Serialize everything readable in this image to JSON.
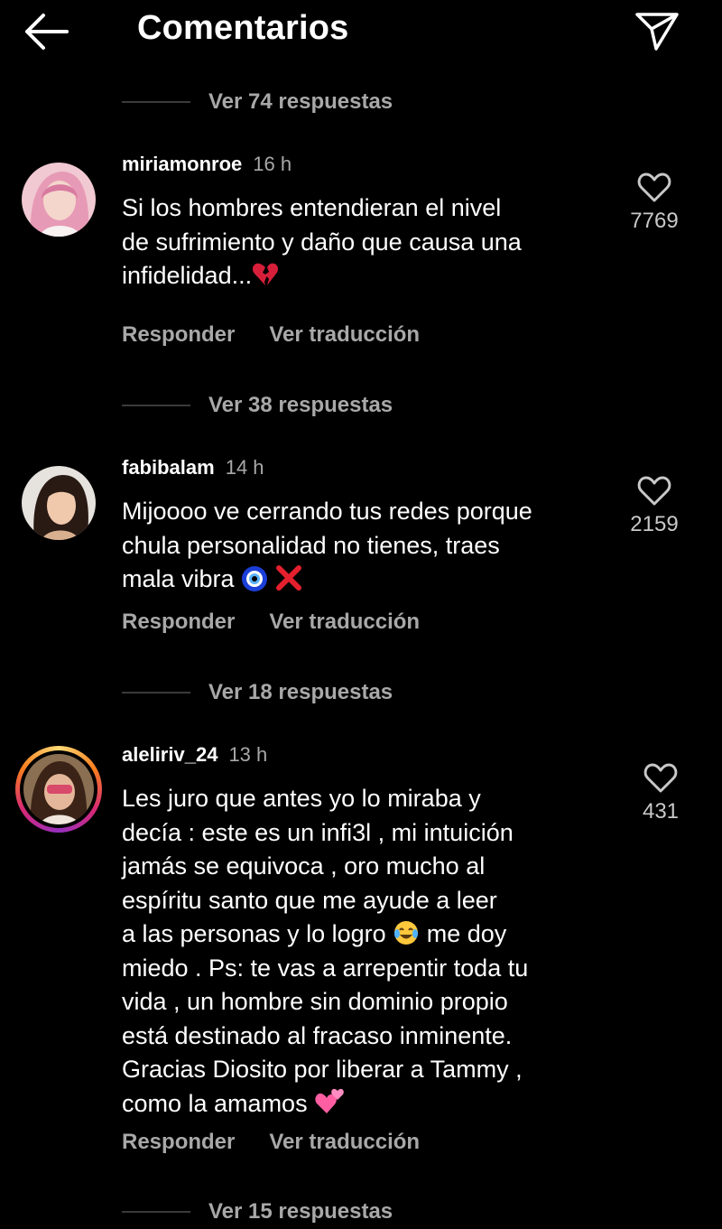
{
  "header": {
    "title": "Comentarios"
  },
  "icons": {
    "back": "arrow-left-icon",
    "send": "paper-plane-icon",
    "like": "heart-outline-icon"
  },
  "colors": {
    "background": "#000000",
    "secondary_text": "#a8a8a8",
    "story_ring": [
      "#feda75",
      "#fa7e1e",
      "#d62976",
      "#962fbf"
    ]
  },
  "threads": [
    {
      "replies_label": "Ver 74 respuestas"
    }
  ],
  "comments": [
    {
      "username": "miriamonroe",
      "time": "16 h",
      "text_lines": [
        "Si los hombres entendieran el nivel",
        "de sufrimiento y daño que causa una",
        "infidelidad..."
      ],
      "emojis": [
        "broken-heart"
      ],
      "likes": "7769",
      "reply_label": "Responder",
      "translate_label": "Ver traducción",
      "replies_label": "Ver 38 respuestas"
    },
    {
      "username": "fabibalam",
      "time": "14 h",
      "text_lines": [
        "Mijoooo ve cerrando tus redes porque",
        "chula personalidad no tienes, traes",
        "mala vibra"
      ],
      "emojis": [
        "nazar-amulet",
        "cross-mark"
      ],
      "likes": "2159",
      "reply_label": "Responder",
      "translate_label": "Ver traducción",
      "replies_label": "Ver 18 respuestas"
    },
    {
      "username": "aleliriv_24",
      "time": "13 h",
      "text_lines": [
        "Les juro que antes yo lo miraba y",
        "decía : este es un infi3l , mi intuición",
        "jamás se equivoca , oro mucho al",
        "espíritu santo que me ayude a leer",
        "a las personas y lo logro",
        "me doy",
        "miedo . Ps: te vas a arrepentir toda tu",
        "vida , un hombre sin dominio propio",
        "está destinado al fracaso inminente.",
        "Gracias Diosito por liberar a Tammy ,",
        "como la amamos"
      ],
      "emojis": [
        "tears-of-joy",
        "two-hearts"
      ],
      "likes": "431",
      "reply_label": "Responder",
      "translate_label": "Ver traducción",
      "replies_label": "Ver 15 respuestas"
    }
  ]
}
